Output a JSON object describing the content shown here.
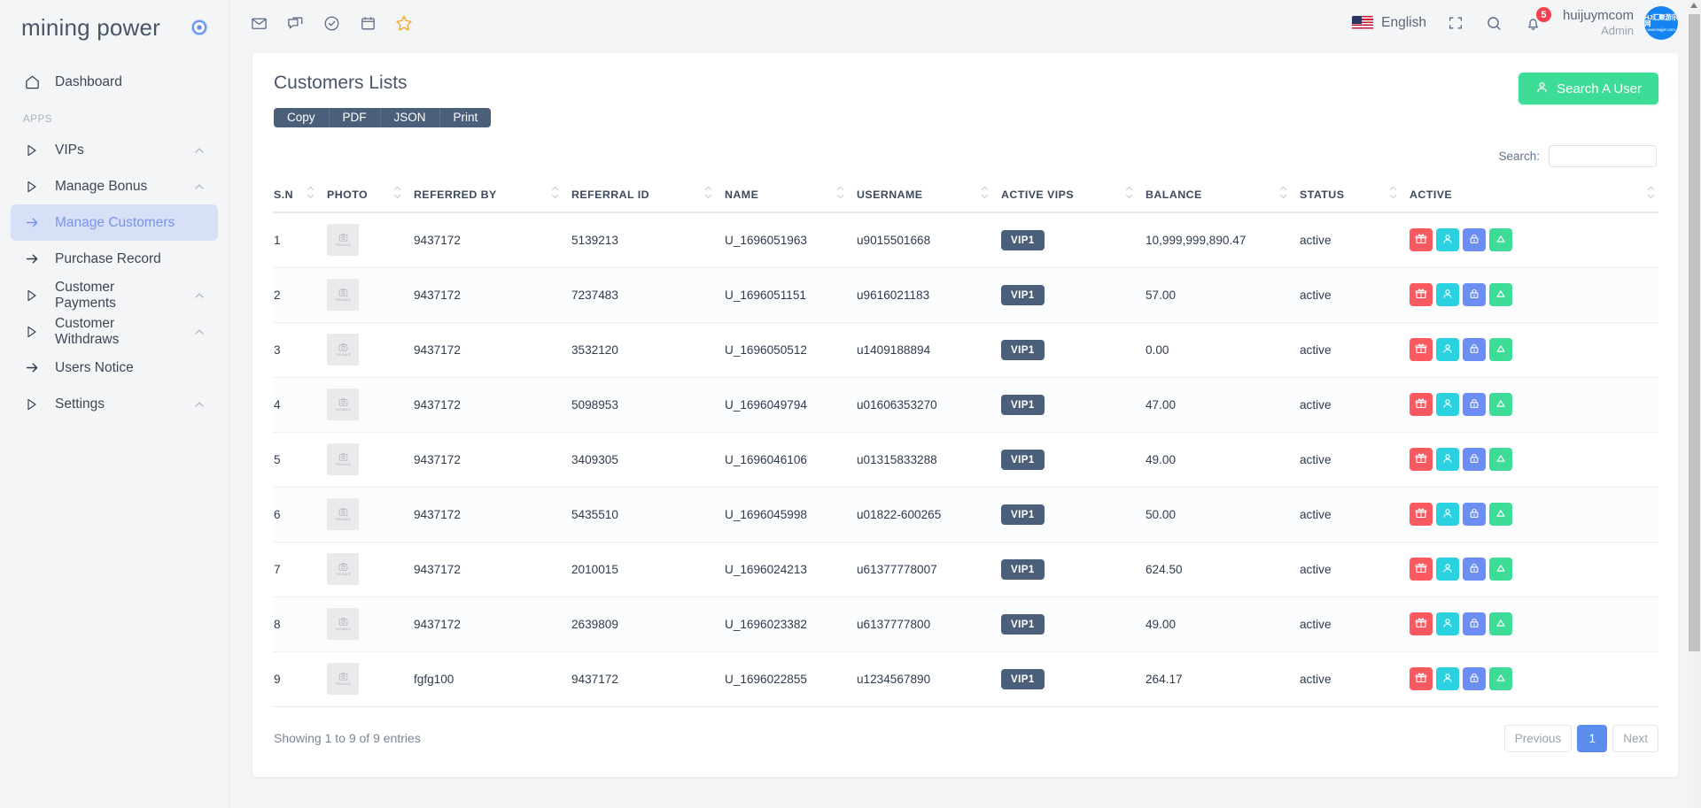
{
  "brand": {
    "name": "mining power",
    "badge_icon": "target-circle-icon"
  },
  "sidebar": {
    "section_label": "APPS",
    "items": [
      {
        "label": "Dashboard",
        "icon": "home-icon",
        "type": "link",
        "active": false
      },
      {
        "label": "VIPs",
        "icon": "triangle-right-icon",
        "type": "group",
        "active": false
      },
      {
        "label": "Manage Bonus",
        "icon": "triangle-right-icon",
        "type": "group",
        "active": false
      },
      {
        "label": "Manage Customers",
        "icon": "arrow-right-icon",
        "type": "link",
        "active": true
      },
      {
        "label": "Purchase Record",
        "icon": "arrow-right-icon",
        "type": "link",
        "active": false
      },
      {
        "label": "Customer Payments",
        "icon": "triangle-right-icon",
        "type": "group",
        "active": false
      },
      {
        "label": "Customer Withdraws",
        "icon": "triangle-right-icon",
        "type": "group",
        "active": false
      },
      {
        "label": "Users Notice",
        "icon": "arrow-right-icon",
        "type": "link",
        "active": false
      },
      {
        "label": "Settings",
        "icon": "triangle-right-icon",
        "type": "group",
        "active": false
      }
    ]
  },
  "topbar": {
    "left_icons": [
      "mail-icon",
      "chat-icon",
      "check-circle-icon",
      "calendar-icon",
      "star-icon"
    ],
    "language": "English",
    "flag": "us-flag-icon",
    "fullscreen_icon": "fullscreen-icon",
    "search_icon": "search-icon",
    "notification_icon": "bell-icon",
    "notification_count": "5",
    "user_name": "huijuymcom",
    "user_role": "Admin",
    "avatar_line1": "HJ汇聚游乐网",
    "avatar_line2": "www.huijym.com"
  },
  "card": {
    "title": "Customers Lists",
    "search_user_button": "Search A User",
    "search_user_icon": "user-icon",
    "export_buttons": [
      "Copy",
      "PDF",
      "JSON",
      "Print"
    ],
    "search_label": "Search:",
    "search_value": "",
    "search_placeholder": ""
  },
  "table": {
    "columns": [
      "S.N",
      "PHOTO",
      "REFERRED BY",
      "REFERRAL ID",
      "NAME",
      "USERNAME",
      "ACTIVE VIPS",
      "BALANCE",
      "STATUS",
      "ACTIVE"
    ],
    "photo_placeholder_text": "THIS IMAGE",
    "action_buttons": [
      {
        "name": "gift-icon",
        "color": "#fa5a5f"
      },
      {
        "name": "user-icon",
        "color": "#2ad2e0"
      },
      {
        "name": "lock-icon",
        "color": "#6c8ef2"
      },
      {
        "name": "triangle-up-icon",
        "color": "#3ddc97"
      }
    ],
    "rows": [
      {
        "sn": "1",
        "referred_by": "9437172",
        "referral_id": "5139213",
        "name": "U_1696051963",
        "username": "u9015501668",
        "vip": "VIP1",
        "balance": "10,999,999,890.47",
        "status": "active"
      },
      {
        "sn": "2",
        "referred_by": "9437172",
        "referral_id": "7237483",
        "name": "U_1696051151",
        "username": "u9616021183",
        "vip": "VIP1",
        "balance": "57.00",
        "status": "active"
      },
      {
        "sn": "3",
        "referred_by": "9437172",
        "referral_id": "3532120",
        "name": "U_1696050512",
        "username": "u1409188894",
        "vip": "VIP1",
        "balance": "0.00",
        "status": "active"
      },
      {
        "sn": "4",
        "referred_by": "9437172",
        "referral_id": "5098953",
        "name": "U_1696049794",
        "username": "u01606353270",
        "vip": "VIP1",
        "balance": "47.00",
        "status": "active"
      },
      {
        "sn": "5",
        "referred_by": "9437172",
        "referral_id": "3409305",
        "name": "U_1696046106",
        "username": "u01315833288",
        "vip": "VIP1",
        "balance": "49.00",
        "status": "active"
      },
      {
        "sn": "6",
        "referred_by": "9437172",
        "referral_id": "5435510",
        "name": "U_1696045998",
        "username": "u01822-600265",
        "vip": "VIP1",
        "balance": "50.00",
        "status": "active"
      },
      {
        "sn": "7",
        "referred_by": "9437172",
        "referral_id": "2010015",
        "name": "U_1696024213",
        "username": "u61377778007",
        "vip": "VIP1",
        "balance": "624.50",
        "status": "active"
      },
      {
        "sn": "8",
        "referred_by": "9437172",
        "referral_id": "2639809",
        "name": "U_1696023382",
        "username": "u6137777800",
        "vip": "VIP1",
        "balance": "49.00",
        "status": "active"
      },
      {
        "sn": "9",
        "referred_by": "fgfg100",
        "referral_id": "9437172",
        "name": "U_1696022855",
        "username": "u1234567890",
        "vip": "VIP1",
        "balance": "264.17",
        "status": "active"
      }
    ]
  },
  "footer": {
    "entries_text": "Showing 1 to 9 of 9 entries",
    "previous_label": "Previous",
    "current_page": "1",
    "next_label": "Next"
  },
  "colors": {
    "accent_green": "#3ddc97",
    "accent_blue": "#5b8def",
    "slate": "#4b5f7a",
    "danger": "#fa5a5f",
    "sidebar_active_bg": "#d7e0f7"
  }
}
